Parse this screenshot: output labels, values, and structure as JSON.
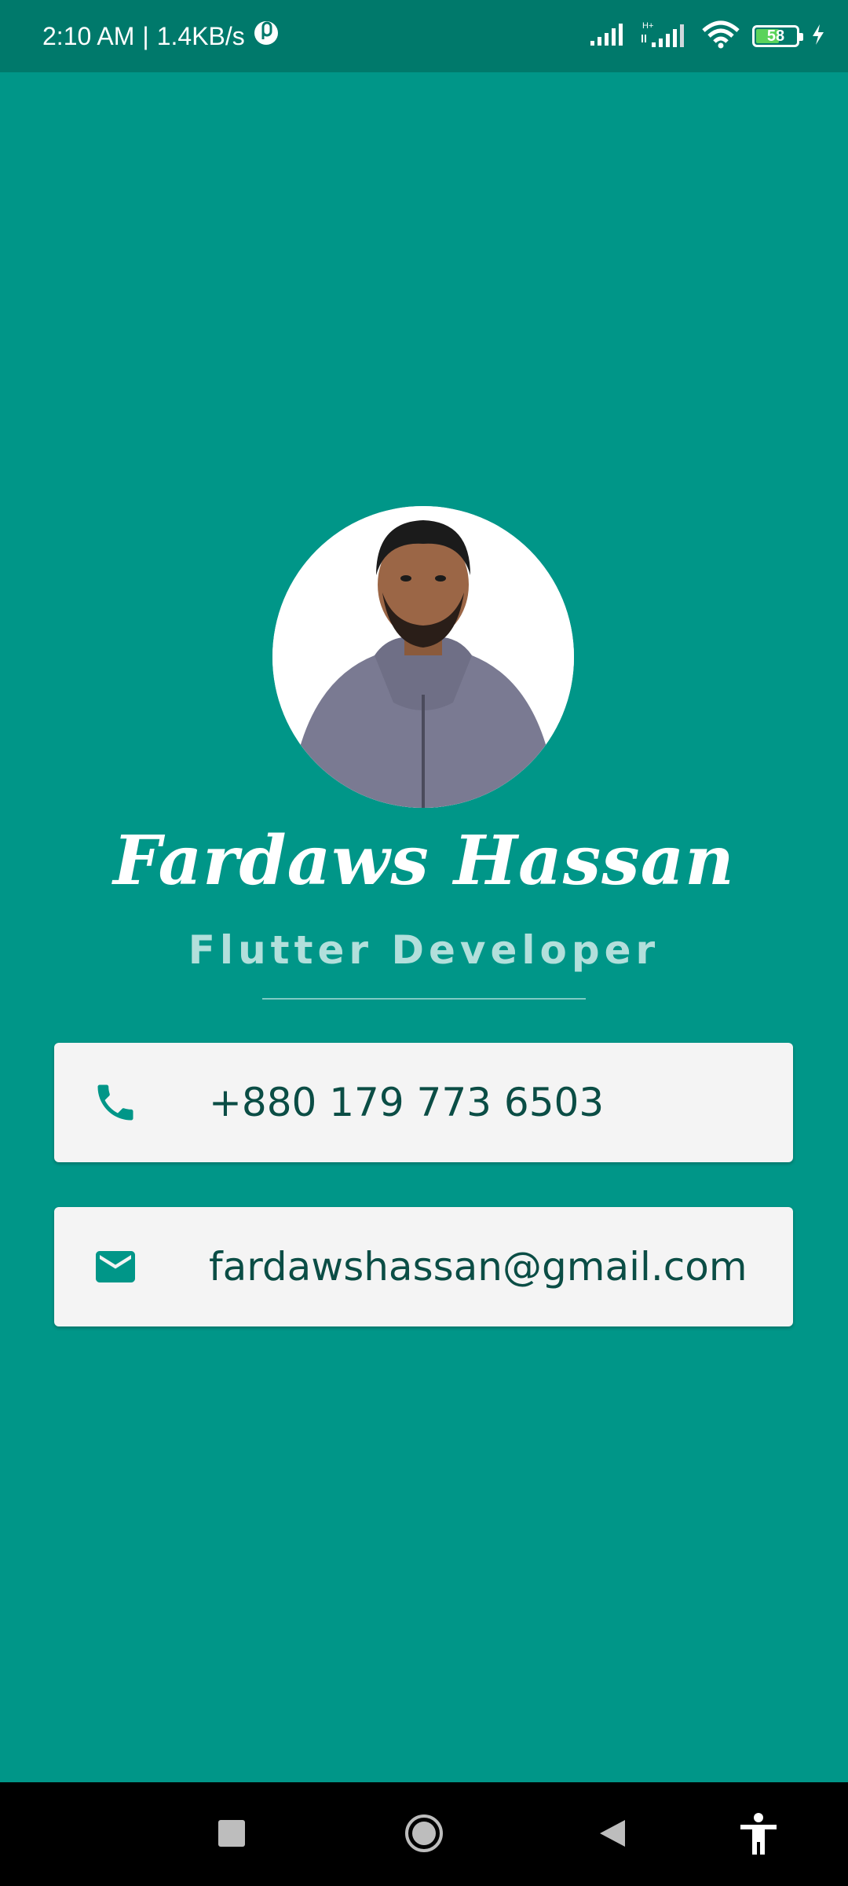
{
  "status_bar": {
    "time": "2:10 AM",
    "network_speed": "1.4KB/s",
    "battery_level": "58",
    "battery_percent": 58,
    "icons": [
      "app-notification-icon",
      "signal-icon",
      "signal-hplus-icon",
      "wifi-icon",
      "battery-icon",
      "charging-icon"
    ]
  },
  "profile": {
    "name": "Fardaws Hassan",
    "title": "Flutter Developer"
  },
  "contacts": {
    "phone": {
      "icon": "phone-icon",
      "value": "+880 179 773 6503"
    },
    "email": {
      "icon": "email-icon",
      "value": "fardawshassan@gmail.com"
    }
  },
  "colors": {
    "background": "#009688",
    "status_bar": "#00796B",
    "card": "#F4F4F4",
    "card_text": "#0B4D45",
    "icon": "#009688",
    "subtitle": "#B2DFDB"
  },
  "nav_bar": {
    "buttons": [
      "recent-apps-button",
      "home-button",
      "back-button",
      "accessibility-button"
    ]
  }
}
